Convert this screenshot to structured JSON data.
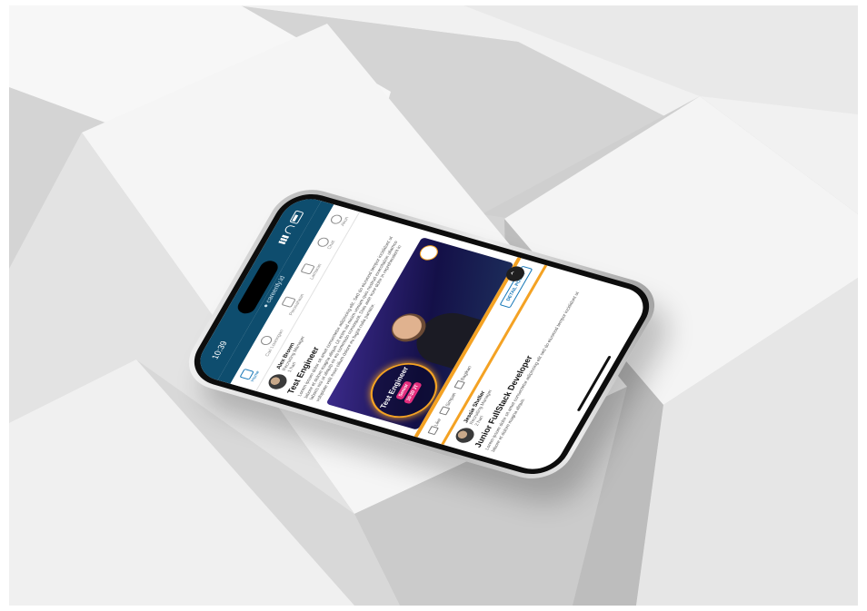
{
  "status_bar": {
    "time": "10:39",
    "domain": "● careerify.id"
  },
  "tabs": [
    {
      "label": "Home",
      "icon": "home-icon"
    },
    {
      "label": "Cari Lowongan",
      "icon": "search-icon"
    },
    {
      "label": "Perusahaan",
      "icon": "building-icon"
    },
    {
      "label": "Lamaran",
      "icon": "document-icon"
    },
    {
      "label": "Chat",
      "icon": "chat-icon"
    },
    {
      "label": "Akun",
      "icon": "user-icon"
    }
  ],
  "posts": [
    {
      "author": "Alex Brown",
      "role": "Recruiting Manager",
      "time": "1 hari",
      "title": "Test Engineer",
      "body": "Lorem ipsum dolor sit amet consectetur adipiscing elit. Sed do eiusmod tempor incididunt ut labore et dolore magna aliqua. Ut enim ad minim veniam quis nostrud exercitation ullamco laboris nisi ut aliquip ex ea commodo consequat. Duis aute irure dolor in reprehenderit in voluptate velit esse cillum dolore eu fugiat nulla pariatur.",
      "media": {
        "headline": "Test Engineer",
        "badge": "Senior",
        "salary": "10-20 JT"
      },
      "actions": {
        "like": "Like",
        "save": "Simpan",
        "share": "Bagikan",
        "detail_button": "DETAIL POSISI"
      }
    },
    {
      "author": "Jessie Sheller",
      "role": "Recruiting Manager",
      "time": "2 hari",
      "title": "Junior FullStack Developer",
      "body": "Lorem ipsum dolor sit amet consectetur adipiscing elit sed do eiusmod tempor incididunt ut labore et dolore magna aliqua."
    }
  ],
  "colors": {
    "brand": "#0e4d6e",
    "accent": "#f4a223",
    "link": "#1577b8",
    "salary": "#e32e7d"
  }
}
